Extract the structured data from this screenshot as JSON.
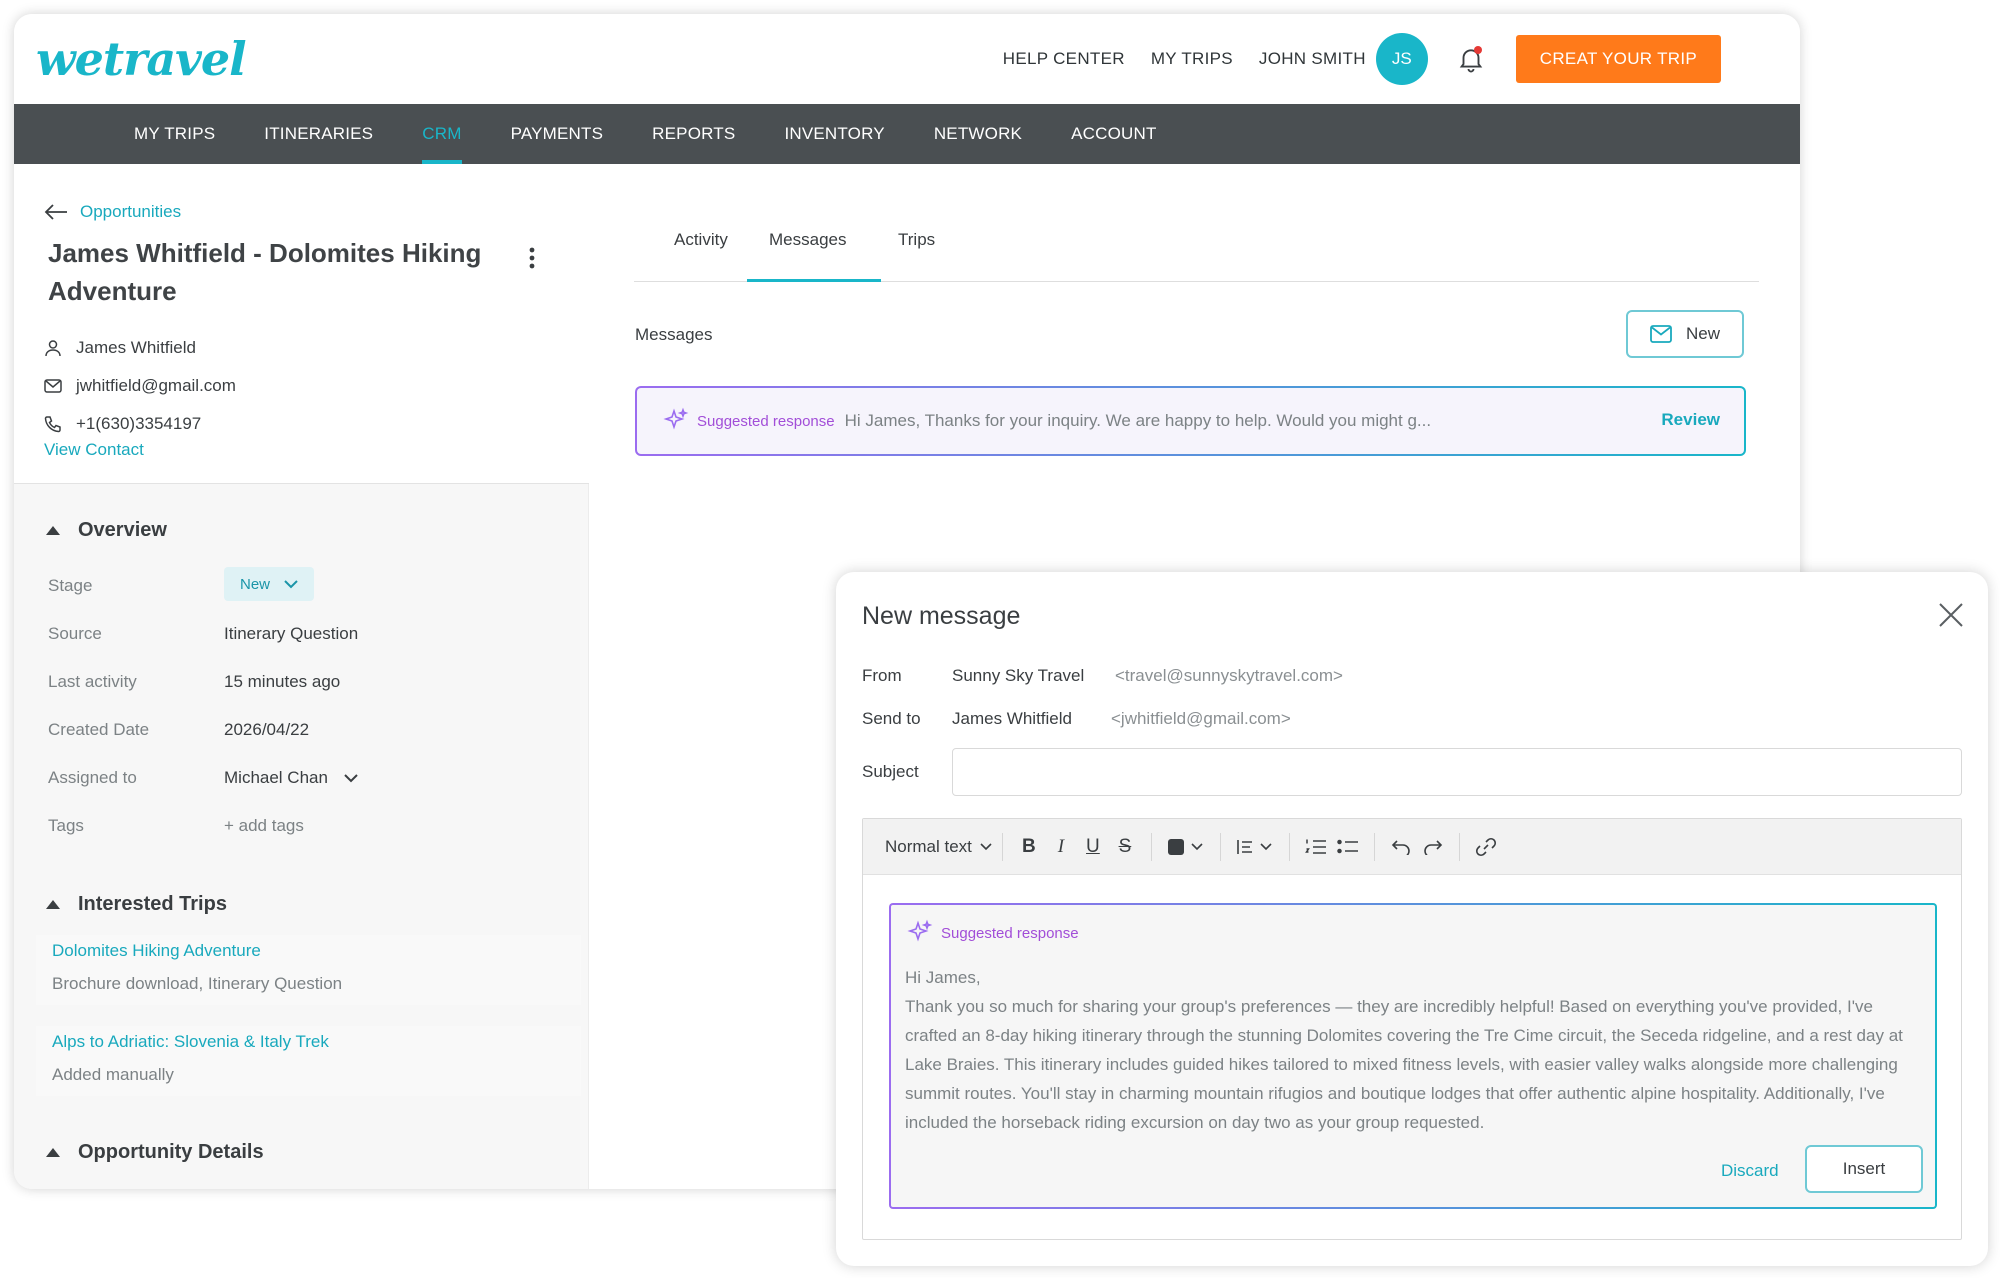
{
  "brand": {
    "logo": "wetravel",
    "accent": "#19b6c9",
    "cta": "#ff7a1a"
  },
  "header": {
    "links": [
      "HELP CENTER",
      "MY TRIPS",
      "JOHN SMITH"
    ],
    "avatar_initials": "JS",
    "create_label": "CREAT YOUR TRIP"
  },
  "nav": {
    "items": [
      "MY TRIPS",
      "ITINERARIES",
      "CRM",
      "PAYMENTS",
      "REPORTS",
      "INVENTORY",
      "NETWORK",
      "ACCOUNT"
    ],
    "active": "CRM"
  },
  "sidebar": {
    "back_label": "Opportunities",
    "title": "James Whitfield - Dolomites Hiking Adventure",
    "contact_name": "James Whitfield",
    "email": "jwhitfield@gmail.com",
    "phone": "+1(630)3354197",
    "view_contact": "View Contact",
    "overview_heading": "Overview",
    "fields": {
      "stage_label": "Stage",
      "stage_value": "New",
      "source_label": "Source",
      "source_value": "Itinerary Question",
      "last_activity_label": "Last activity",
      "last_activity_value": "15 minutes ago",
      "created_label": "Created Date",
      "created_value": "2026/04/22",
      "assigned_label": "Assigned to",
      "assigned_value": "Michael Chan",
      "tags_label": "Tags",
      "tags_value": "+ add tags"
    },
    "interested_heading": "Interested Trips",
    "trips": [
      {
        "name": "Dolomites Hiking Adventure",
        "detail": "Brochure download, Itinerary Question"
      },
      {
        "name": "Alps to Adriatic: Slovenia & Italy Trek",
        "detail": "Added manually"
      }
    ],
    "details_heading": "Opportunity Details"
  },
  "main": {
    "tabs": [
      "Activity",
      "Messages",
      "Trips"
    ],
    "active_tab": "Messages",
    "messages_label": "Messages",
    "new_label": "New",
    "suggestion": {
      "tag": "Suggested response",
      "preview": "Hi James, Thanks for your inquiry. We are happy to help. Would you might g...",
      "review_label": "Review"
    }
  },
  "modal": {
    "title": "New message",
    "from_label": "From",
    "from_name": "Sunny Sky Travel",
    "from_addr": "<travel@sunnyskytravel.com>",
    "to_label": "Send to",
    "to_name": "James Whitfield",
    "to_addr": "<jwhitfield@gmail.com>",
    "subject_label": "Subject",
    "subject_value": "",
    "toolbar": {
      "text_style": "Normal text"
    },
    "suggestion": {
      "tag": "Suggested response",
      "greeting": "Hi James,",
      "body": "Thank you so much for sharing your group's preferences — they are incredibly helpful! Based on everything you've provided, I've crafted an 8-day hiking itinerary through the stunning Dolomites covering the Tre Cime circuit, the Seceda ridgeline, and a rest day at Lake Braies. This itinerary includes guided hikes tailored to mixed fitness levels, with easier valley walks alongside more challenging summit routes. You'll stay in charming mountain rifugios and boutique lodges that offer authentic alpine hospitality. Additionally, I've included the horseback riding excursion on day two as your group requested.",
      "discard_label": "Discard",
      "insert_label": "Insert"
    }
  }
}
